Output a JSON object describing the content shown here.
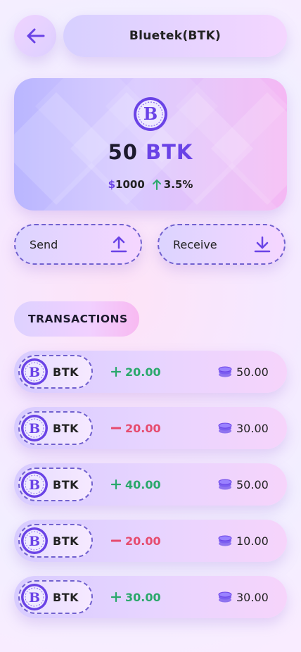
{
  "header": {
    "title": "Bluetek(BTK)"
  },
  "balance": {
    "amount": "50",
    "symbol": "BTK",
    "usd_value": "1000",
    "currency_symbol": "$",
    "change": "3.5%"
  },
  "actions": {
    "send_label": "Send",
    "receive_label": "Receive"
  },
  "section": {
    "title": "TRANSACTIONS"
  },
  "transactions": [
    {
      "symbol": "BTK",
      "direction": "plus",
      "change": "20.00",
      "balance": "50.00"
    },
    {
      "symbol": "BTK",
      "direction": "minus",
      "change": "20.00",
      "balance": "30.00"
    },
    {
      "symbol": "BTK",
      "direction": "plus",
      "change": "40.00",
      "balance": "50.00"
    },
    {
      "symbol": "BTK",
      "direction": "minus",
      "change": "20.00",
      "balance": "10.00"
    },
    {
      "symbol": "BTK",
      "direction": "plus",
      "change": "30.00",
      "balance": "30.00"
    }
  ],
  "colors": {
    "accent": "#6a43e6",
    "positive": "#2aa86b",
    "negative": "#e64b6e"
  },
  "icons": {
    "back": "arrow-left-icon",
    "send": "upload-arrow-icon",
    "receive": "download-arrow-icon",
    "coin": "btk-coin-icon",
    "balance": "coin-stack-icon"
  }
}
